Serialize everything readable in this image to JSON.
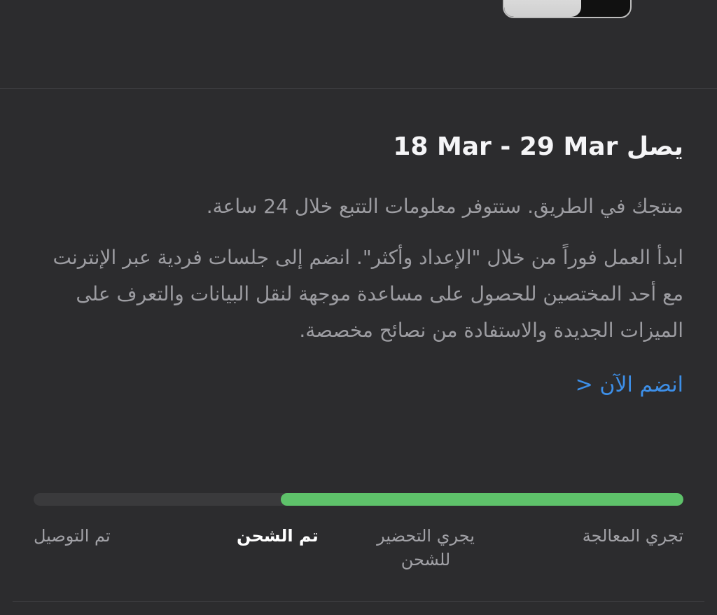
{
  "delivery": {
    "prefix": "يصل",
    "dates": "18 Mar - 29 Mar"
  },
  "status_message": "منتجك في الطريق. ستتوفر معلومات التتبع خلال 24 ساعة.",
  "setup_message": "ابدأ العمل فوراً من خلال \"الإعداد وأكثر\". انضم إلى جلسات فردية عبر الإنترنت مع أحد المختصين للحصول على مساعدة موجهة لنقل البيانات والتعرف على الميزات الجديدة والاستفادة من نصائح مخصصة.",
  "join_link": "انضم الآن <",
  "progress": {
    "fraction": 0.62,
    "current_step_index": 2,
    "steps": [
      "تجري المعالجة",
      "يجري التحضير للشحن",
      "تم الشحن",
      "تم التوصيل"
    ]
  },
  "colors": {
    "background": "#2c2c2e",
    "progress_fill": "#5ec26a",
    "progress_track": "#3a3a3c",
    "link": "#3d8fe8"
  }
}
